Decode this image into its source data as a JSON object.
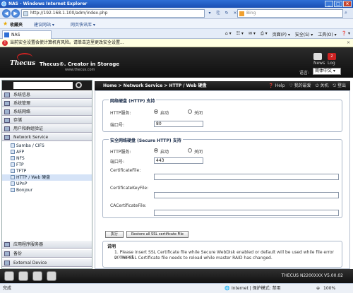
{
  "browser": {
    "title": "NAS - Windows Internet Explorer",
    "address": "http://192.168.1.100/adm/index.php",
    "search_placeholder": "Bing",
    "favorites_label": "收藏夹",
    "favorites_items": [
      "建议网站 ▾",
      "网页快讯库 ▾"
    ],
    "tab_label": "NAS",
    "commands": [
      "页面(P) ▾",
      "安全(S) ▾",
      "工具(O) ▾",
      "❓ ▾"
    ],
    "security_warning": "当前安全设置会使计算机有风险。请单击这里更改安全设置...",
    "status_left": "完成",
    "status_zone": "Internet | 保护模式: 禁用",
    "status_zoom": "100%"
  },
  "nas_header": {
    "logo": "Thecus",
    "tagline": "Thecus®. Creator in Storage",
    "url": "www.thecus.com",
    "news_label": "News",
    "log_label": "Log",
    "log_badge": "2",
    "language_label": "语言:",
    "language_value": "简体中文 ▾"
  },
  "sidebar": {
    "categories": [
      "系统信息",
      "系统管理",
      "系统网络",
      "存储",
      "用户和群组验证",
      "Network Service"
    ],
    "services": [
      "Samba / CIFS",
      "AFP",
      "NFS",
      "FTP",
      "TFTP",
      "HTTP / Web 硬盘",
      "UPnP",
      "Bonjour"
    ],
    "bottom_categories": [
      "应用程序服务器",
      "备份",
      "External Device"
    ]
  },
  "main": {
    "breadcrumb": "Home > Network Service > HTTP / Web 硬盘",
    "tools": [
      "❓ Help",
      "♡ 我的最爱",
      "⏻ 关机",
      "⎋ 登出"
    ],
    "http_group": "网络硬盘 (HTTP) 支持",
    "http_service_label": "HTTP服务:",
    "enable": "启动",
    "disable": "关闭",
    "port_label": "端口号:",
    "http_port": "80",
    "https_group": "安全网络硬盘 (Secure HTTP) 支持",
    "https_port": "443",
    "cert_label": "CertificateFile:",
    "certkey_label": "CertificateKeyFile:",
    "cacert_label": "CACertificateFile:",
    "apply_button": "执行",
    "restore_button": "Restore all SSL certificate File",
    "notes_title": "说明",
    "notes": [
      "1. Please insert SSL Certificate file while Secure WebDisk enabled or default will be used while file error occurred.",
      "2. The SSL Certificate file needs to reload while master RAID has changed."
    ]
  },
  "bottom": {
    "model": "THECUS N2200XXX V5.00.02"
  }
}
